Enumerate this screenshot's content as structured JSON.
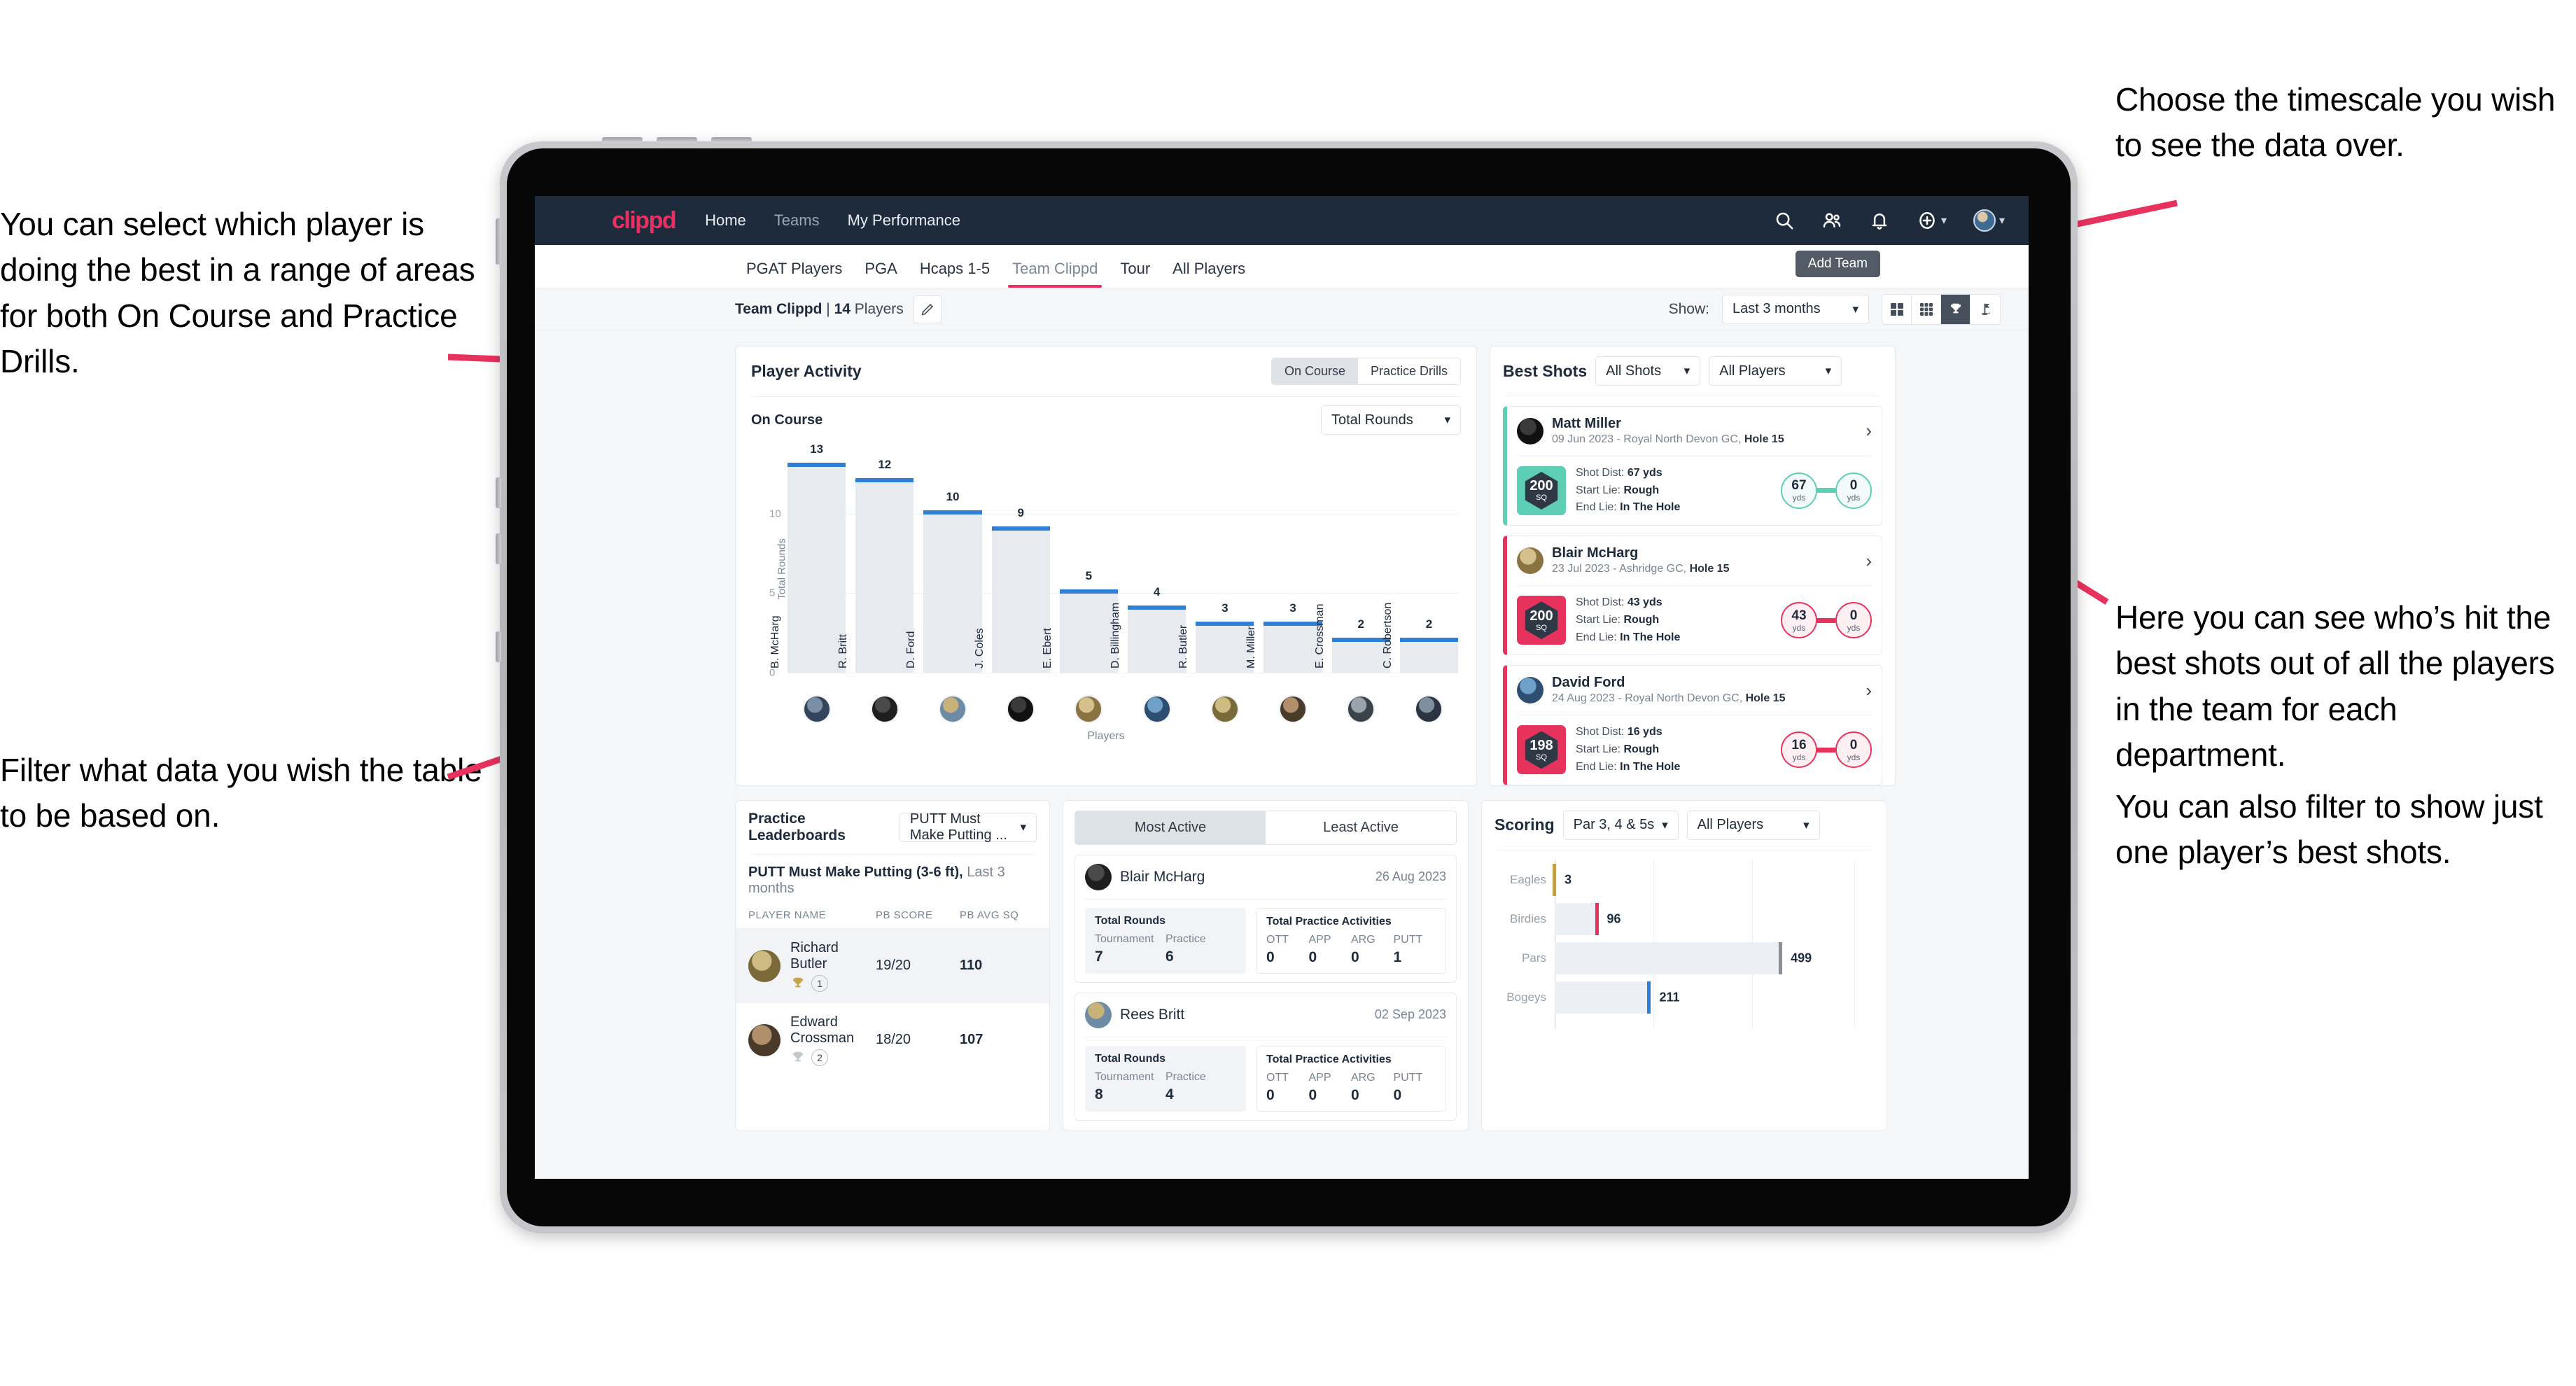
{
  "annotations": {
    "top_left": "You can select which player is doing the best in a range of areas for both On Course and Practice Drills.",
    "bottom_left": "Filter what data you wish the table to be based on.",
    "top_right": "Choose the timescale you wish to see the data over.",
    "mid_right": "Here you can see who’s hit the best shots out of all the players in the team for each department.",
    "bottom_right": "You can also filter to show just one player’s best shots."
  },
  "appbar": {
    "logo": "clippd",
    "nav": [
      {
        "label": "Home",
        "dim": false
      },
      {
        "label": "Teams",
        "dim": true
      },
      {
        "label": "My Performance",
        "dim": false
      }
    ],
    "icons": [
      "search-icon",
      "people-icon",
      "bell-icon",
      "plus-circle-icon",
      "avatar"
    ]
  },
  "tabs": [
    {
      "label": "PGAT Players",
      "active": false
    },
    {
      "label": "PGA",
      "active": false
    },
    {
      "label": "Hcaps 1-5",
      "active": false
    },
    {
      "label": "Team Clippd",
      "active": true
    },
    {
      "label": "Tour",
      "active": false
    },
    {
      "label": "All Players",
      "active": false
    }
  ],
  "tooltip": {
    "add_team": "Add Team"
  },
  "toolbar": {
    "team_name": "Team Clippd",
    "separator": " | ",
    "player_count": "14",
    "players_word": " Players",
    "edit_icon": "pencil-icon",
    "show_label": "Show:",
    "show_value": "Last 3 months",
    "views": [
      {
        "name": "grid-2x2-view-icon",
        "active": false
      },
      {
        "name": "grid-3x3-view-icon",
        "active": false
      },
      {
        "name": "trophy-view-icon",
        "active": true
      },
      {
        "name": "golf-flag-view-icon",
        "active": false
      }
    ]
  },
  "player_activity": {
    "title": "Player Activity",
    "segments": [
      {
        "label": "On Course",
        "active": true
      },
      {
        "label": "Practice Drills",
        "active": false
      }
    ],
    "sub_label": "On Course",
    "metric_select": "Total Rounds"
  },
  "best_shots": {
    "title": "Best Shots",
    "shot_filter": "All Shots",
    "player_filter": "All Players",
    "cards": [
      {
        "name": "Matt Miller",
        "meta_date": "09 Jun 2023",
        "meta_course": " - Royal North Devon GC, ",
        "meta_hole": "Hole 15",
        "sq_value": "200",
        "sq_unit": "SQ",
        "shot_dist_label": "Shot Dist: ",
        "shot_dist": "67 yds",
        "start_lie_label": "Start Lie: ",
        "start_lie": "Rough",
        "end_lie_label": "End Lie: ",
        "end_lie": "In The Hole",
        "from_value": "67",
        "from_unit": "yds",
        "to_value": "0",
        "to_unit": "yds",
        "accent": "#5ECFB4"
      },
      {
        "name": "Blair McHarg",
        "meta_date": "23 Jul 2023",
        "meta_course": " - Ashridge GC, ",
        "meta_hole": "Hole 15",
        "sq_value": "200",
        "sq_unit": "SQ",
        "shot_dist_label": "Shot Dist: ",
        "shot_dist": "43 yds",
        "start_lie_label": "Start Lie: ",
        "start_lie": "Rough",
        "end_lie_label": "End Lie: ",
        "end_lie": "In The Hole",
        "from_value": "43",
        "from_unit": "yds",
        "to_value": "0",
        "to_unit": "yds",
        "accent": "#E8325E"
      },
      {
        "name": "David Ford",
        "meta_date": "24 Aug 2023",
        "meta_course": " - Royal North Devon GC, ",
        "meta_hole": "Hole 15",
        "sq_value": "198",
        "sq_unit": "SQ",
        "shot_dist_label": "Shot Dist: ",
        "shot_dist": "16 yds",
        "start_lie_label": "Start Lie: ",
        "start_lie": "Rough",
        "end_lie_label": "End Lie: ",
        "end_lie": "In The Hole",
        "from_value": "16",
        "from_unit": "yds",
        "to_value": "0",
        "to_unit": "yds",
        "accent": "#E8325E"
      }
    ]
  },
  "practice_leaderboards": {
    "title": "Practice Leaderboards",
    "drill_select": "PUTT Must Make Putting ...",
    "sub_bold": "PUTT Must Make Putting (3-6 ft),",
    "sub_rest": " Last 3 months",
    "columns": [
      "PLAYER NAME",
      "PB SCORE",
      "PB AVG SQ"
    ],
    "rows": [
      {
        "name": "Richard Butler",
        "rank": "1",
        "trophy": "gold",
        "pb_score": "19/20",
        "pb_avg_sq": "110",
        "highlight": true
      },
      {
        "name": "Edward Crossman",
        "rank": "2",
        "trophy": "silver",
        "pb_score": "18/20",
        "pb_avg_sq": "107",
        "highlight": false
      }
    ]
  },
  "activity_panel": {
    "tabs": [
      {
        "label": "Most Active",
        "active": true
      },
      {
        "label": "Least Active",
        "active": false
      }
    ],
    "rounds_title": "Total Rounds",
    "practice_title": "Total Practice Activities",
    "rounds_cols": [
      "Tournament",
      "Practice"
    ],
    "practice_cols": [
      "OTT",
      "APP",
      "ARG",
      "PUTT"
    ],
    "cards": [
      {
        "name": "Blair McHarg",
        "date": "26 Aug 2023",
        "rounds": [
          "7",
          "6"
        ],
        "practice": [
          "0",
          "0",
          "0",
          "1"
        ]
      },
      {
        "name": "Rees Britt",
        "date": "02 Sep 2023",
        "rounds": [
          "8",
          "4"
        ],
        "practice": [
          "0",
          "0",
          "0",
          "0"
        ]
      }
    ]
  },
  "scoring": {
    "title": "Scoring",
    "par_filter": "Par 3, 4 & 5s",
    "player_filter": "All Players"
  },
  "chart_data": [
    {
      "type": "bar",
      "id": "player-activity",
      "title": "Player Activity — On Course",
      "xlabel": "Players",
      "ylabel": "Total Rounds",
      "ylim": [
        0,
        14
      ],
      "yticks": [
        0,
        5,
        10
      ],
      "grid": true,
      "legend": "none",
      "bar_color": "#E7EAEF",
      "cap_color": "#2F7FD4",
      "categories": [
        "B. McHarg",
        "R. Britt",
        "D. Ford",
        "J. Coles",
        "E. Ebert",
        "D. Billingham",
        "R. Butler",
        "M. Miller",
        "E. Crossman",
        "C. Robertson"
      ],
      "values": [
        13,
        12,
        10,
        9,
        5,
        4,
        3,
        3,
        2,
        2
      ]
    },
    {
      "type": "bar",
      "id": "scoring",
      "orientation": "horizontal",
      "title": "Scoring",
      "xlabel": "",
      "ylabel": "",
      "xlim": [
        0,
        700
      ],
      "grid": true,
      "legend": "none",
      "categories": [
        "Eagles",
        "Birdies",
        "Pars",
        "Bogeys"
      ],
      "values": [
        3,
        96,
        499,
        211
      ],
      "colors": [
        "#C59C4A",
        "#E8325E",
        "#8A8F97",
        "#2F7FD4"
      ]
    }
  ]
}
